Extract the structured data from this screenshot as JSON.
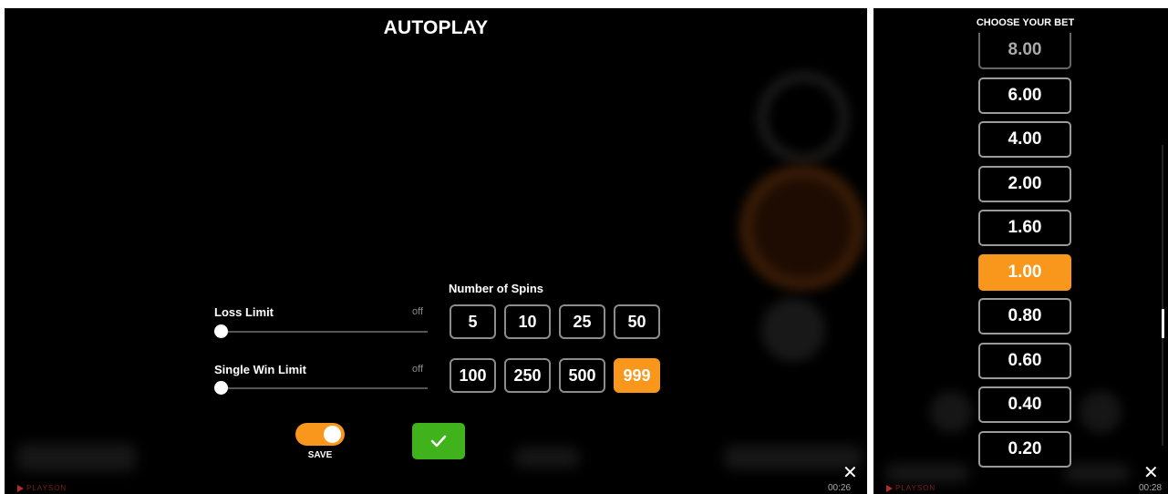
{
  "autoplay": {
    "title": "AUTOPLAY",
    "loss_limit": {
      "label": "Loss Limit",
      "value": "off",
      "slider_fraction": 0
    },
    "single_win_limit": {
      "label": "Single Win Limit",
      "value": "off",
      "slider_fraction": 0
    },
    "spins": {
      "label": "Number of Spins",
      "options": [
        "5",
        "10",
        "25",
        "50",
        "100",
        "250",
        "500",
        "999"
      ],
      "selected": "999"
    },
    "save": {
      "label": "SAVE",
      "on": true
    },
    "confirm_icon": "checkmark-icon",
    "brand": "PLAYSON",
    "timer": "00:26",
    "close_icon": "close-icon"
  },
  "bet_panel": {
    "title": "CHOOSE YOUR BET",
    "options": [
      "8.00",
      "6.00",
      "4.00",
      "2.00",
      "1.60",
      "1.00",
      "0.80",
      "0.60",
      "0.40",
      "0.20"
    ],
    "selected": "1.00",
    "brand": "PLAYSON",
    "timer": "00:28",
    "close_icon": "close-icon"
  },
  "colors": {
    "accent_orange": "#f8971c",
    "confirm_green": "#3fb21c",
    "background": "#000000"
  }
}
